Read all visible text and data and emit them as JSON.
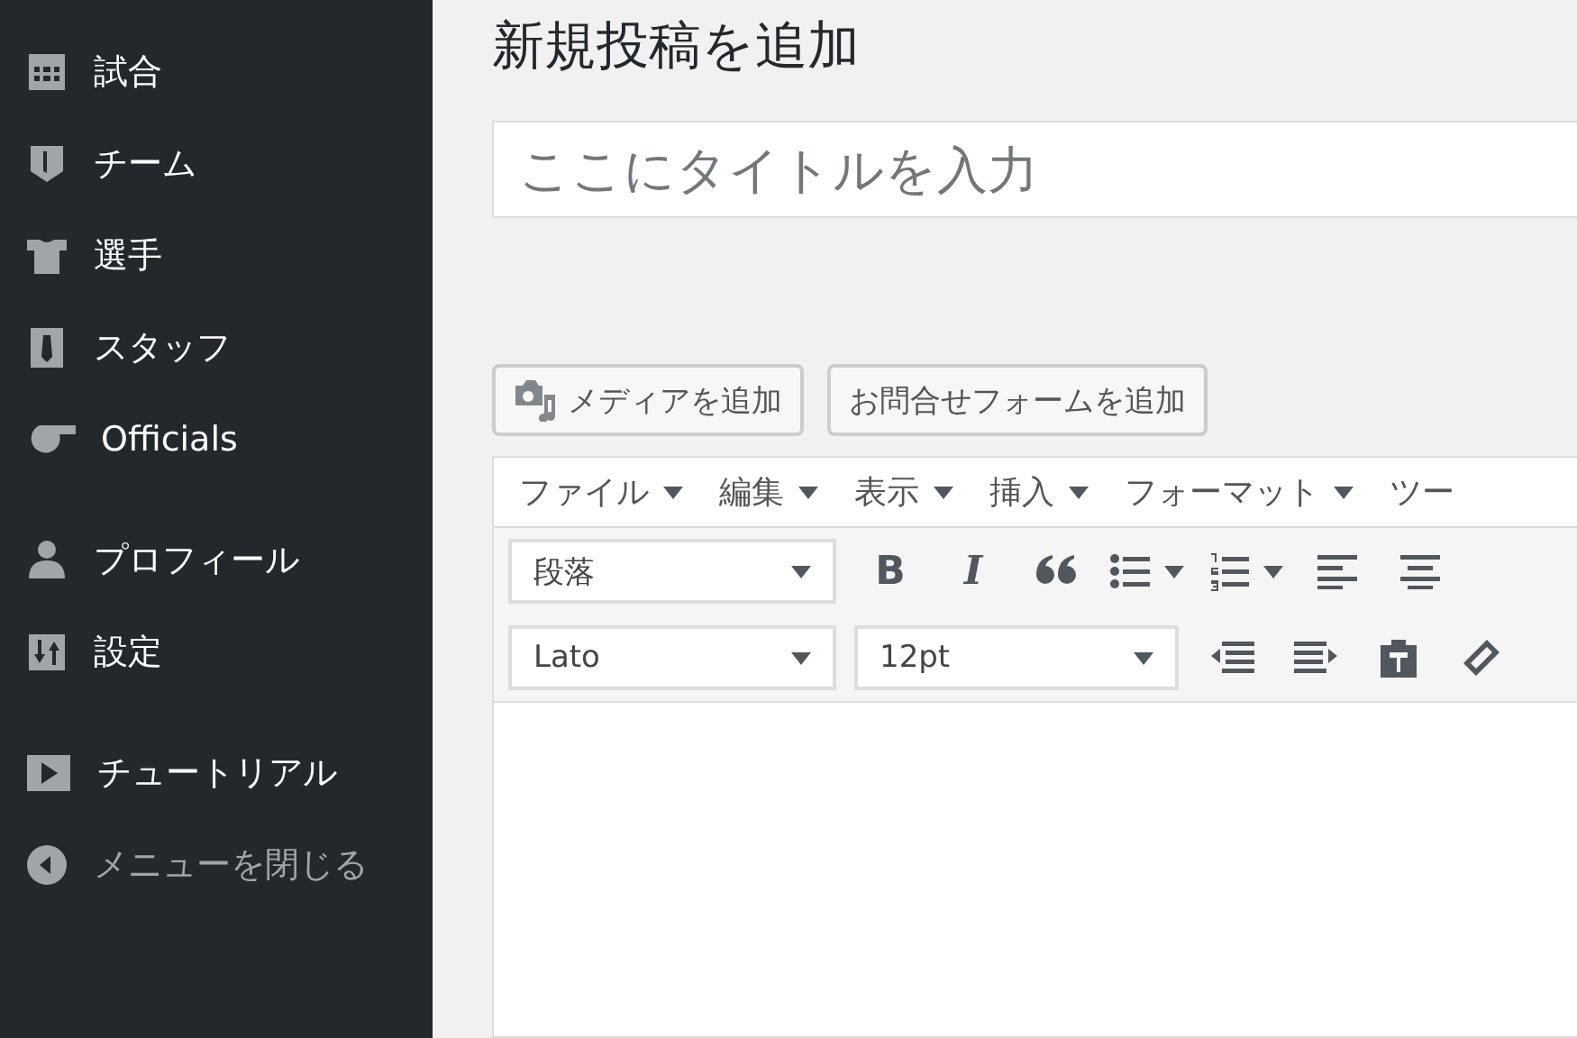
{
  "sidebar": {
    "groups": [
      [
        {
          "label": "試合"
        },
        {
          "label": "チーム"
        },
        {
          "label": "選手"
        },
        {
          "label": "スタッフ"
        },
        {
          "label": "Officials"
        }
      ],
      [
        {
          "label": "プロフィール"
        },
        {
          "label": "設定"
        }
      ],
      [
        {
          "label": "チュートリアル"
        }
      ]
    ],
    "collapse": {
      "label": "メニューを閉じる"
    }
  },
  "heading": "新規投稿を追加",
  "title_field": {
    "placeholder": "ここにタイトルを入力"
  },
  "media_buttons": [
    "メディアを追加",
    "お問合せフォームを追加"
  ],
  "editor": {
    "menus": [
      "ファイル",
      "編集",
      "表示",
      "挿入",
      "フォーマット",
      "ツー"
    ],
    "format_select": "段落",
    "font_select": "Lato",
    "size_select": "12pt",
    "row1_tools": [
      {
        "kind": "text",
        "glyph": "B"
      },
      {
        "kind": "italic",
        "glyph": "I"
      },
      {
        "kind": "quote"
      },
      {
        "kind": "bullets"
      },
      {
        "kind": "numbers"
      },
      {
        "kind": "align-left"
      },
      {
        "kind": "align-center"
      }
    ],
    "row2_tools": [
      {
        "kind": "outdent"
      },
      {
        "kind": "indent"
      },
      {
        "kind": "paste"
      },
      {
        "kind": "eraser"
      }
    ]
  }
}
